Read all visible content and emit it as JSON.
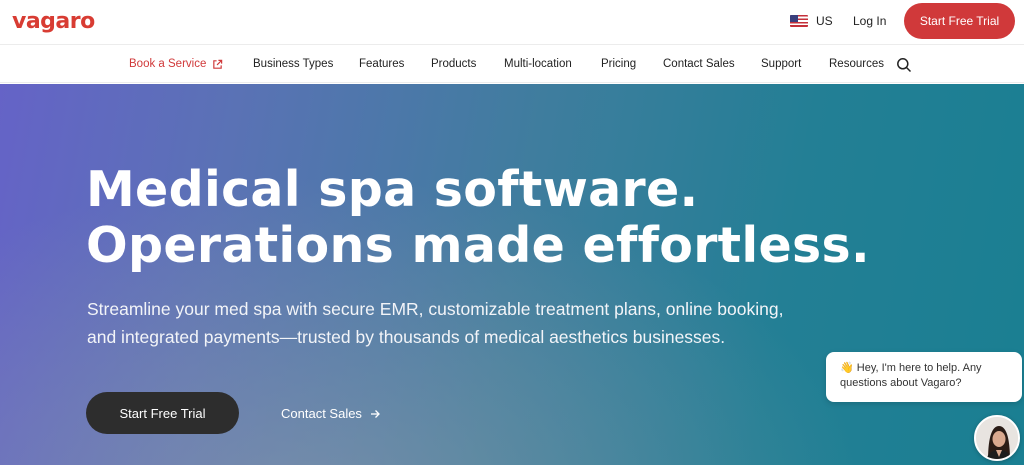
{
  "header": {
    "logo": "vagaro",
    "locale": "US",
    "login": "Log In",
    "cta": "Start Free Trial"
  },
  "nav": {
    "items": [
      {
        "label": "Book a Service",
        "icon": "external-link-icon"
      },
      {
        "label": "Business Types"
      },
      {
        "label": "Features"
      },
      {
        "label": "Products"
      },
      {
        "label": "Multi-location"
      },
      {
        "label": "Pricing"
      },
      {
        "label": "Contact Sales"
      },
      {
        "label": "Support"
      },
      {
        "label": "Resources"
      }
    ],
    "search_icon": "search-icon"
  },
  "hero": {
    "headline_line1": "Medical spa software.",
    "headline_line2": "Operations made effortless.",
    "subtext_line1": "Streamline your med spa with secure EMR, customizable treatment plans, online booking,",
    "subtext_line2": "and integrated payments—trusted by thousands of medical aesthetics businesses.",
    "primary_cta": "Start Free Trial",
    "secondary_cta": "Contact Sales",
    "secondary_cta_icon": "arrow-right-icon"
  },
  "chat": {
    "emoji": "👋",
    "message": "Hey, I'm here to help. Any questions about Vagaro?"
  },
  "colors": {
    "brand": "#d0393a",
    "dark_button": "#2d2d2d",
    "hero_start": "#6563c7",
    "hero_end": "#1a7f92"
  }
}
